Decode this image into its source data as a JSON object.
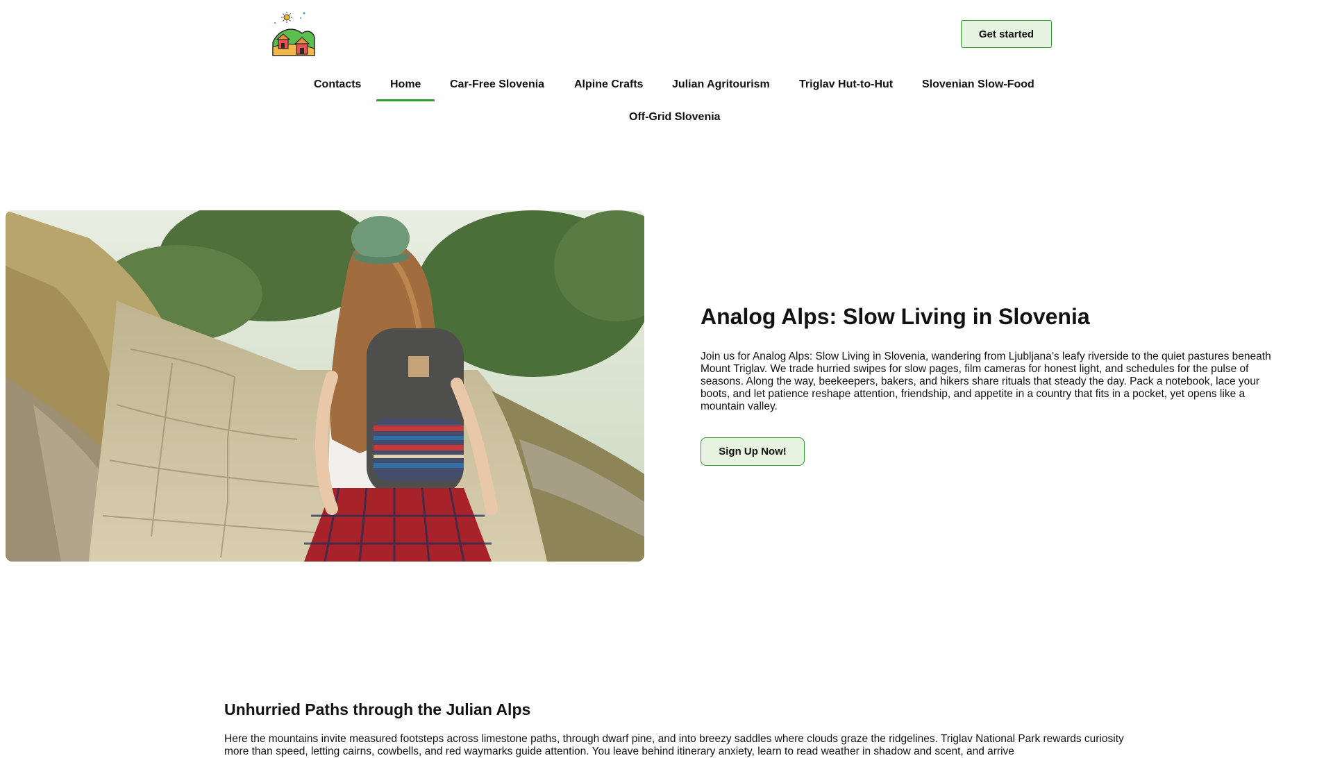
{
  "header": {
    "logo_icon": "village-hill-logo-icon",
    "cta_label": "Get started"
  },
  "nav": {
    "items": [
      {
        "label": "Contacts",
        "active": false
      },
      {
        "label": "Home",
        "active": true
      },
      {
        "label": "Car-Free Slovenia",
        "active": false
      },
      {
        "label": "Alpine Crafts",
        "active": false
      },
      {
        "label": "Julian Agritourism",
        "active": false
      },
      {
        "label": "Triglav Hut-to-Hut",
        "active": false
      },
      {
        "label": "Slovenian Slow-Food",
        "active": false
      },
      {
        "label": "Off-Grid Slovenia",
        "active": false
      }
    ]
  },
  "hero": {
    "image_icon": "hiker-on-stone-path-photo",
    "title": "Analog Alps: Slow Living in Slovenia",
    "text": "Join us for Analog Alps: Slow Living in Slovenia, wandering from Ljubljana’s leafy riverside to the quiet pastures beneath Mount Triglav. We trade hurried swipes for slow pages, film cameras for honest light, and schedules for the pulse of seasons. Along the way, beekeepers, bakers, and hikers share rituals that steady the day. Pack a notebook, lace your boots, and let patience reshape attention, friendship, and appetite in a country that fits in a pocket, yet opens like a mountain valley.",
    "cta_label": "Sign Up Now!"
  },
  "section": {
    "title": "Unhurried Paths through the Julian Alps",
    "text": "Here the mountains invite measured footsteps across limestone paths, through dwarf pine, and into breezy saddles where clouds graze the ridgelines. Triglav National Park rewards curiosity more than speed, letting cairns, cowbells, and red waymarks guide attention. You leave behind itinerary anxiety, learn to read weather in shadow and scent, and arrive"
  },
  "colors": {
    "accent_green": "#2f9e2f",
    "button_fill": "#e6f3e1"
  }
}
